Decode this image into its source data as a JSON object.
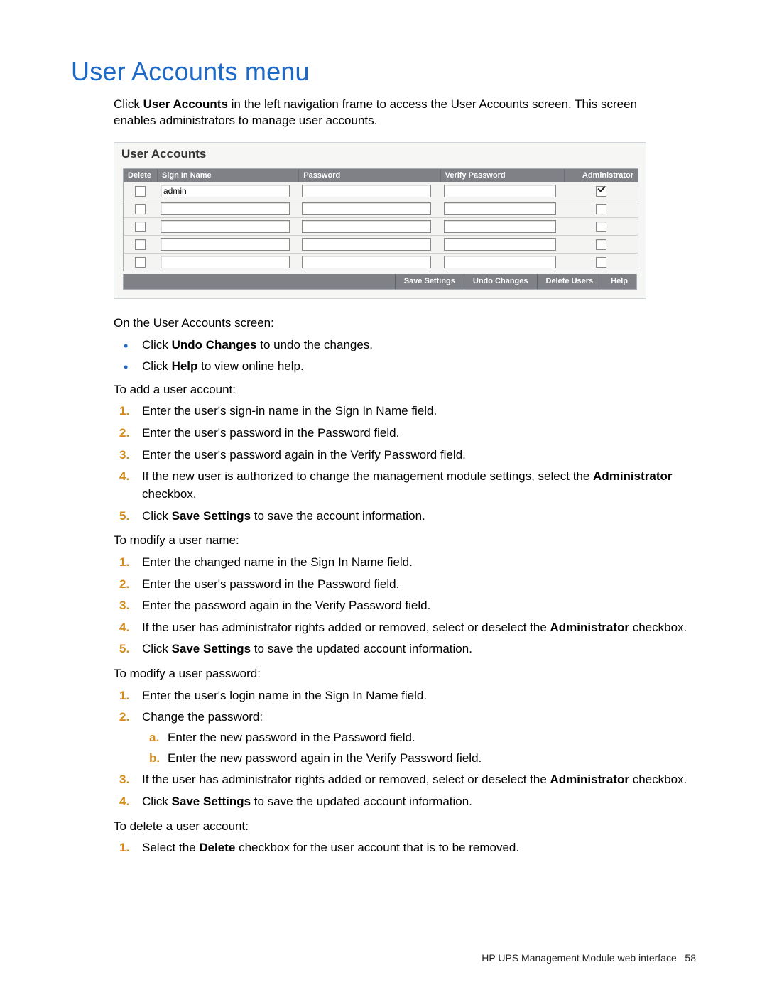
{
  "title": "User Accounts menu",
  "intro_pre": "Click ",
  "intro_bold": "User Accounts",
  "intro_post": " in the left navigation frame to access the User Accounts screen. This screen enables administrators to manage user accounts.",
  "panel": {
    "title": "User Accounts",
    "cols": {
      "delete": "Delete",
      "name": "Sign In Name",
      "pw": "Password",
      "vpw": "Verify Password",
      "admin": "Administrator"
    },
    "rows": [
      {
        "delete": false,
        "name": "admin",
        "admin": true
      },
      {
        "delete": false,
        "name": "",
        "admin": false
      },
      {
        "delete": false,
        "name": "",
        "admin": false
      },
      {
        "delete": false,
        "name": "",
        "admin": false
      },
      {
        "delete": false,
        "name": "",
        "admin": false
      }
    ],
    "buttons": {
      "save": "Save Settings",
      "undo": "Undo Changes",
      "del": "Delete Users",
      "help": "Help"
    }
  },
  "body": {
    "screen_lead": "On the User Accounts screen:",
    "bullets": [
      {
        "pre": "Click ",
        "bold": "Undo Changes",
        "post": " to undo the changes."
      },
      {
        "pre": "Click ",
        "bold": "Help",
        "post": " to view online help."
      }
    ],
    "add_lead": "To add a user account:",
    "add_steps": [
      {
        "t": "Enter the user's sign-in name in the Sign In Name field."
      },
      {
        "t": "Enter the user's password in the Password field."
      },
      {
        "t": "Enter the user's password again in the Verify Password field."
      },
      {
        "pre": "If the new user is authorized to change the management module settings, select the ",
        "bold": "Administrator",
        "post": " checkbox."
      },
      {
        "pre": "Click ",
        "bold": "Save Settings",
        "post": " to save the account information."
      }
    ],
    "mod_name_lead": "To modify a user name:",
    "mod_name_steps": [
      {
        "t": "Enter the changed name in the Sign In Name field."
      },
      {
        "t": "Enter the user's password in the Password field."
      },
      {
        "t": "Enter the password again in the Verify Password field."
      },
      {
        "pre": "If the user has administrator rights added or removed, select or deselect the ",
        "bold": "Administrator",
        "post": " checkbox."
      },
      {
        "pre": "Click ",
        "bold": "Save Settings",
        "post": " to save the updated account information."
      }
    ],
    "mod_pw_lead": "To modify a user password:",
    "mod_pw_steps": [
      {
        "t": "Enter the user's login name in the Sign In Name field."
      },
      {
        "t": "Change the password:",
        "sub": [
          {
            "t": "Enter the new password in the Password field."
          },
          {
            "t": "Enter the new password again in the Verify Password field."
          }
        ]
      },
      {
        "pre": "If the user has administrator rights added or removed, select or deselect the ",
        "bold": "Administrator",
        "post": " checkbox."
      },
      {
        "pre": "Click ",
        "bold": "Save Settings",
        "post": " to save the updated account information."
      }
    ],
    "del_lead": "To delete a user account:",
    "del_steps": [
      {
        "pre": "Select the ",
        "bold": "Delete",
        "post": " checkbox for the user account that is to be removed."
      }
    ]
  },
  "footer": {
    "text": "HP UPS Management Module web interface",
    "page": "58"
  }
}
